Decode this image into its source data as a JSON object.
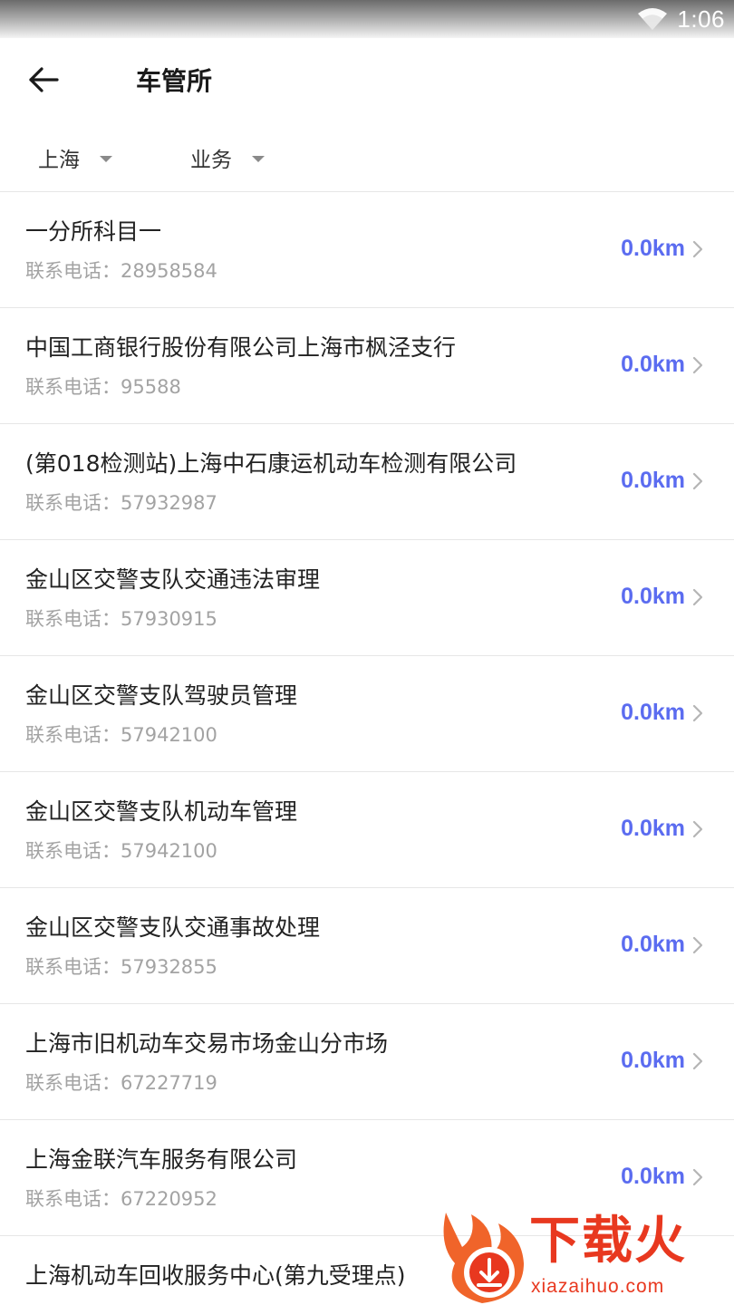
{
  "status_bar": {
    "time": "1:06",
    "wifi_icon": "wifi-icon"
  },
  "header": {
    "back_icon": "arrow-left-icon",
    "title": "车管所"
  },
  "filters": {
    "city": "上海",
    "business": "业务"
  },
  "list": {
    "items": [
      {
        "name": "一分所科目一",
        "phone": "联系电话：28958584",
        "distance": "0.0km"
      },
      {
        "name": "中国工商银行股份有限公司上海市枫泾支行",
        "phone": "联系电话：95588",
        "distance": "0.0km"
      },
      {
        "name": "(第018检测站)上海中石康运机动车检测有限公司",
        "phone": "联系电话：57932987",
        "distance": "0.0km"
      },
      {
        "name": "金山区交警支队交通违法审理",
        "phone": "联系电话：57930915",
        "distance": "0.0km"
      },
      {
        "name": "金山区交警支队驾驶员管理",
        "phone": "联系电话：57942100",
        "distance": "0.0km"
      },
      {
        "name": "金山区交警支队机动车管理",
        "phone": "联系电话：57942100",
        "distance": "0.0km"
      },
      {
        "name": "金山区交警支队交通事故处理",
        "phone": "联系电话：57932855",
        "distance": "0.0km"
      },
      {
        "name": "上海市旧机动车交易市场金山分市场",
        "phone": "联系电话：67227719",
        "distance": "0.0km"
      },
      {
        "name": "上海金联汽车服务有限公司",
        "phone": "联系电话：67220952",
        "distance": "0.0km"
      },
      {
        "name": "上海机动车回收服务中心(第九受理点)",
        "phone": "",
        "distance": ""
      }
    ]
  },
  "watermark": {
    "brand": "下载火",
    "domain": "xiazaihuo.com"
  },
  "colors": {
    "accent": "#5b6cf0",
    "watermark": "#e8381f"
  }
}
